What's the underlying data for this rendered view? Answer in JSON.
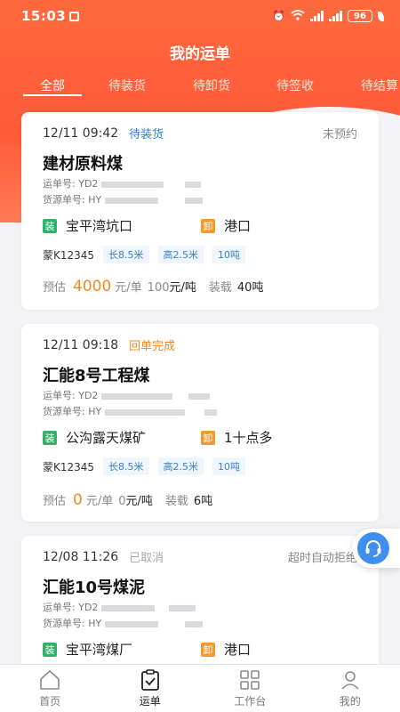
{
  "status_bar": {
    "time": "15:03",
    "battery": "96"
  },
  "header": {
    "title": "我的运单"
  },
  "tabs": [
    {
      "label": "全部",
      "active": true
    },
    {
      "label": "待装货"
    },
    {
      "label": "待卸货"
    },
    {
      "label": "待签收"
    },
    {
      "label": "待结算"
    }
  ],
  "orders": [
    {
      "time": "12/11 09:42",
      "status": "待装货",
      "status_color": "#2f7dcc",
      "right_status": "未预约",
      "cargo": "建材原料煤",
      "waybill_label": "运单号:",
      "waybill": "YD2",
      "source_label": "货源单号:",
      "source": "HY",
      "load_badge": "装",
      "load": "宝平湾坑口",
      "unload_badge": "卸",
      "unload": "港口",
      "plate": "蒙K12345",
      "length": "长8.5米",
      "height": "高2.5米",
      "weight": "10吨",
      "est_label": "预估",
      "price": "4000",
      "unit": "元/单",
      "per_ton": "100",
      "per_ton_unit": "元/吨",
      "load_label": "装载",
      "load_amount": "40吨"
    },
    {
      "time": "12/11 09:18",
      "status": "回单完成",
      "status_color": "#f08a1f",
      "cargo": "汇能8号工程煤",
      "waybill_label": "运单号:",
      "waybill": "YD2",
      "source_label": "货源单号:",
      "source": "HY",
      "load_badge": "装",
      "load": "公沟露天煤矿",
      "unload_badge": "卸",
      "unload": "1十点多",
      "plate": "蒙K12345",
      "length": "长8.5米",
      "height": "高2.5米",
      "weight": "10吨",
      "est_label": "预估",
      "price": "0",
      "unit": "元/单",
      "per_ton": "0",
      "per_ton_unit": "元/吨",
      "load_label": "装载",
      "load_amount": "6吨"
    },
    {
      "time": "12/08 11:26",
      "status": "已取消",
      "status_color": "#aaaaaa",
      "right_status": "超时自动拒绝",
      "cargo": "汇能10号煤泥",
      "waybill_label": "运单号:",
      "waybill": "YD2",
      "source_label": "货源单号:",
      "source": "HY",
      "load_badge": "装",
      "load": "宝平湾煤厂",
      "unload_badge": "卸",
      "unload": "港口"
    }
  ],
  "bottom_nav": [
    {
      "label": "首页",
      "icon": "home-icon"
    },
    {
      "label": "运单",
      "icon": "waybill-icon",
      "active": true
    },
    {
      "label": "工作台",
      "icon": "workbench-icon"
    },
    {
      "label": "我的",
      "icon": "user-icon"
    }
  ],
  "colors": {
    "accent": "#ff5a38",
    "price": "#f08a1f",
    "tag_text": "#3b82c4",
    "load": "#2fb36b",
    "unload": "#f29a2e"
  }
}
